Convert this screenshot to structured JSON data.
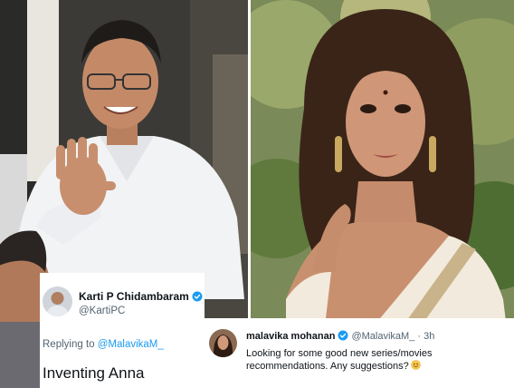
{
  "left_tweet": {
    "name": "Karti P Chidambaram",
    "handle": "@KartiPC",
    "reply_prefix": "Replying to",
    "reply_to": "@MalavikaM_",
    "text": "Inventing Anna"
  },
  "right_tweet": {
    "name": "malavika mohanan",
    "handle": "@MalavikaM_",
    "time": "· 3h",
    "text": "Looking for some good new series/movies recommendations. Any suggestions?"
  },
  "colors": {
    "twitter_blue": "#1d9bf0",
    "text_primary": "#0f1419",
    "text_secondary": "#536471"
  },
  "icons": {
    "verified": "verified-badge-icon",
    "emoji": "smiling-face-icon"
  }
}
